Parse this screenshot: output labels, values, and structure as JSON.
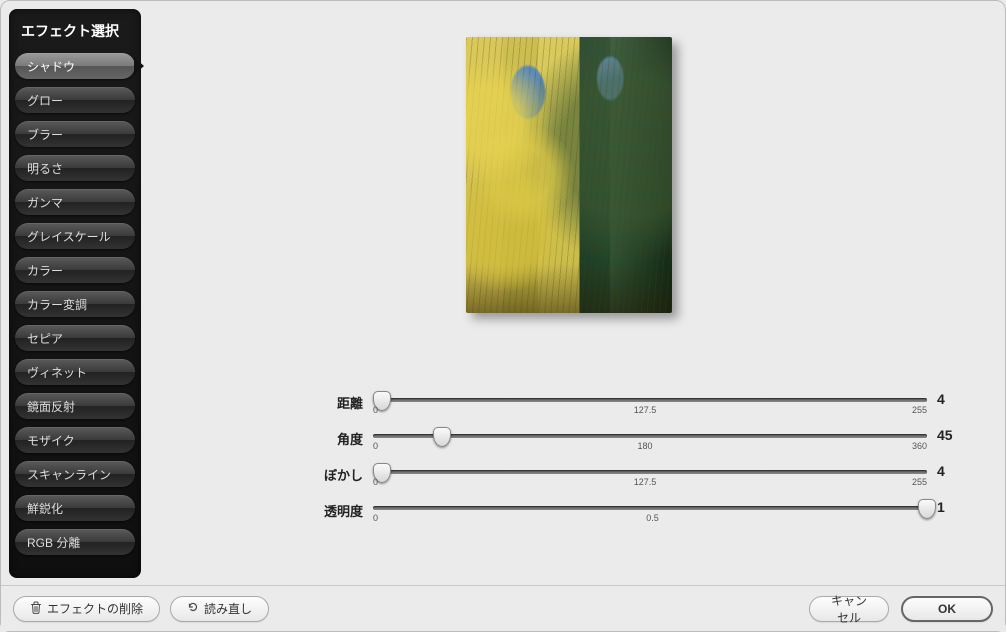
{
  "sidebar": {
    "title": "エフェクト選択",
    "items": [
      {
        "label": "シャドウ",
        "selected": true
      },
      {
        "label": "グロー"
      },
      {
        "label": "ブラー"
      },
      {
        "label": "明るさ"
      },
      {
        "label": "ガンマ"
      },
      {
        "label": "グレイスケール"
      },
      {
        "label": "カラー"
      },
      {
        "label": "カラー変調"
      },
      {
        "label": "セピア"
      },
      {
        "label": "ヴィネット"
      },
      {
        "label": "鏡面反射"
      },
      {
        "label": "モザイク"
      },
      {
        "label": "スキャンライン"
      },
      {
        "label": "鮮鋭化"
      },
      {
        "label": "RGB 分離"
      }
    ]
  },
  "sliders": [
    {
      "label": "距離",
      "min": "0",
      "mid": "127.5",
      "max": "255",
      "value": "4",
      "pos_pct": 1.6
    },
    {
      "label": "角度",
      "min": "0",
      "mid": "180",
      "max": "360",
      "value": "45",
      "pos_pct": 12.5
    },
    {
      "label": "ぼかし",
      "min": "0",
      "mid": "127.5",
      "max": "255",
      "value": "4",
      "pos_pct": 1.6
    },
    {
      "label": "透明度",
      "min": "0",
      "mid": "0.5",
      "max": "",
      "value": "1",
      "pos_pct": 100
    }
  ],
  "footer": {
    "delete_effect": "エフェクトの削除",
    "reload": "読み直し",
    "cancel": "キャンセル",
    "ok": "OK"
  }
}
